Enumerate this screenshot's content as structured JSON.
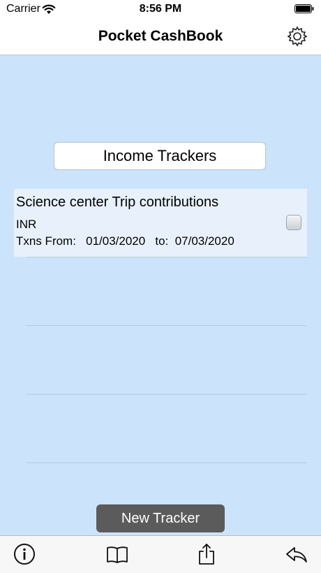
{
  "status_bar": {
    "carrier": "Carrier",
    "time": "8:56 PM"
  },
  "nav": {
    "title": "Pocket CashBook",
    "settings_icon": "gear-icon"
  },
  "section": {
    "label": "Income Trackers"
  },
  "trackers": [
    {
      "title": "Science center Trip contributions",
      "currency": "INR",
      "dates_text": "Txns From:   01/03/2020   to:  07/03/2020",
      "checked": false
    }
  ],
  "new_tracker_label": "New Tracker",
  "toolbar": {
    "icons": [
      "info-icon",
      "book-icon",
      "share-icon",
      "reply-icon"
    ]
  },
  "colors": {
    "background": "#cce4fb",
    "row": "#e8f1fb",
    "button_dark": "#5b5b5b"
  }
}
